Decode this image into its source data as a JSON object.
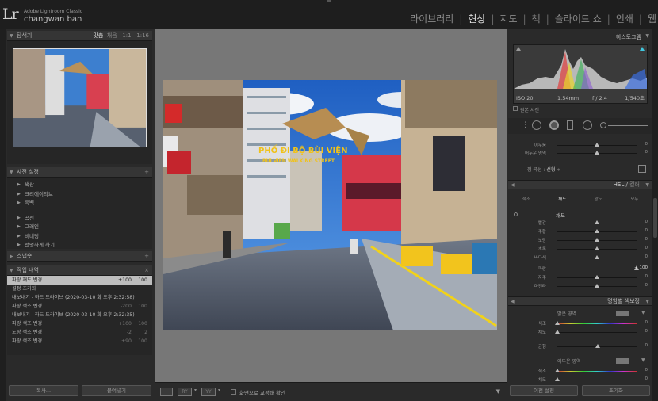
{
  "app": {
    "logo": "Lr",
    "name": "Adobe Lightroom Classic",
    "user": "changwan ban"
  },
  "modules": [
    {
      "label": "라이브러리",
      "active": false
    },
    {
      "label": "현상",
      "active": true
    },
    {
      "label": "지도",
      "active": false
    },
    {
      "label": "책",
      "active": false
    },
    {
      "label": "슬라이드 쇼",
      "active": false
    },
    {
      "label": "인쇄",
      "active": false
    },
    {
      "label": "웹",
      "active": false
    }
  ],
  "navigator": {
    "title": "탐색기",
    "zoom_options": [
      "맞춤",
      "채움",
      "1:1",
      "1:16"
    ]
  },
  "presets": {
    "title": "사전 설정",
    "add": "+",
    "items": [
      "색상",
      "크리에이티브",
      "흑백",
      "곡선",
      "그레인",
      "비네팅",
      "선명하게 하기"
    ]
  },
  "snapshots": {
    "title": "스냅숏",
    "add": "+"
  },
  "history": {
    "title": "작업 내역",
    "close": "×",
    "items": [
      {
        "label": "파랑 채도 변경",
        "a": "+100",
        "b": "100",
        "selected": true
      },
      {
        "label": "설정 초기화",
        "a": "",
        "b": "",
        "selected": false
      },
      {
        "label": "내보내기 - 하드 드라이브 (2020-03-10 화 오후 2:32:58)",
        "a": "",
        "b": "",
        "selected": false
      },
      {
        "label": "파랑 색조 변경",
        "a": "-200",
        "b": "100",
        "selected": false
      },
      {
        "label": "내보내기 - 하드 드라이브 (2020-03-10 화 오후 2:32:35)",
        "a": "",
        "b": "",
        "selected": false
      },
      {
        "label": "파랑 색조 변경",
        "a": "+100",
        "b": "100",
        "selected": false
      },
      {
        "label": "노랑 색조 변경",
        "a": "-2",
        "b": "2",
        "selected": false
      },
      {
        "label": "파랑 색조 변경",
        "a": "+90",
        "b": "100",
        "selected": false
      }
    ]
  },
  "left_buttons": {
    "copy": "복사...",
    "paste": "붙여넣기"
  },
  "toolbar": {
    "show_label": "화면으로 교정쇄 확인",
    "ry": "RY",
    "yy": "YY"
  },
  "photo_sign": {
    "line1": "PHỐ ĐI BỘ BÙI VIỆN",
    "line2": "BUI VIEN WALKING STREET"
  },
  "histogram": {
    "title": "히스토그램",
    "iso": "ISO 20",
    "focal": "1.54mm",
    "aperture": "f / 2.4",
    "shutter": "1/540초",
    "original_label": "원본 사진"
  },
  "sliders_top": [
    {
      "label": "어두움",
      "value": "0",
      "pos": 0.5
    },
    {
      "label": "어두운 영역",
      "value": "0",
      "pos": 0.5
    }
  ],
  "point_curve": {
    "label": "점 곡선 :",
    "value": "선형"
  },
  "hsl": {
    "title": "HSL",
    "title_sep": "/",
    "title_alt": "컬러",
    "tabs": [
      "색조",
      "채도",
      "광도",
      "모두"
    ],
    "active_tab": 1,
    "section_label": "채도",
    "items": [
      {
        "label": "빨강",
        "value": "0",
        "pos": 0.5
      },
      {
        "label": "주황",
        "value": "0",
        "pos": 0.5
      },
      {
        "label": "노랑",
        "value": "0",
        "pos": 0.5
      },
      {
        "label": "초록",
        "value": "0",
        "pos": 0.5
      },
      {
        "label": "바다색",
        "value": "0",
        "pos": 0.5
      },
      {
        "label": "파랑",
        "value": "+ 100",
        "pos": 1.0
      },
      {
        "label": "자주",
        "value": "0",
        "pos": 0.5
      },
      {
        "label": "마젠타",
        "value": "0",
        "pos": 0.5
      }
    ]
  },
  "split_toning": {
    "title": "명암별 색보정",
    "highlights": "밝은 영역",
    "shadows": "어두운 영역",
    "balance": "균형",
    "sliders": [
      {
        "label": "색조",
        "value": "0",
        "pos": 0.0
      },
      {
        "label": "채도",
        "value": "0",
        "pos": 0.0
      }
    ],
    "balance_value": "0",
    "shadow_sliders": [
      {
        "label": "색조",
        "value": "0",
        "pos": 0.0
      },
      {
        "label": "채도",
        "value": "0",
        "pos": 0.0
      }
    ]
  },
  "right_buttons": {
    "prev": "이전 설정",
    "reset": "초기화"
  }
}
